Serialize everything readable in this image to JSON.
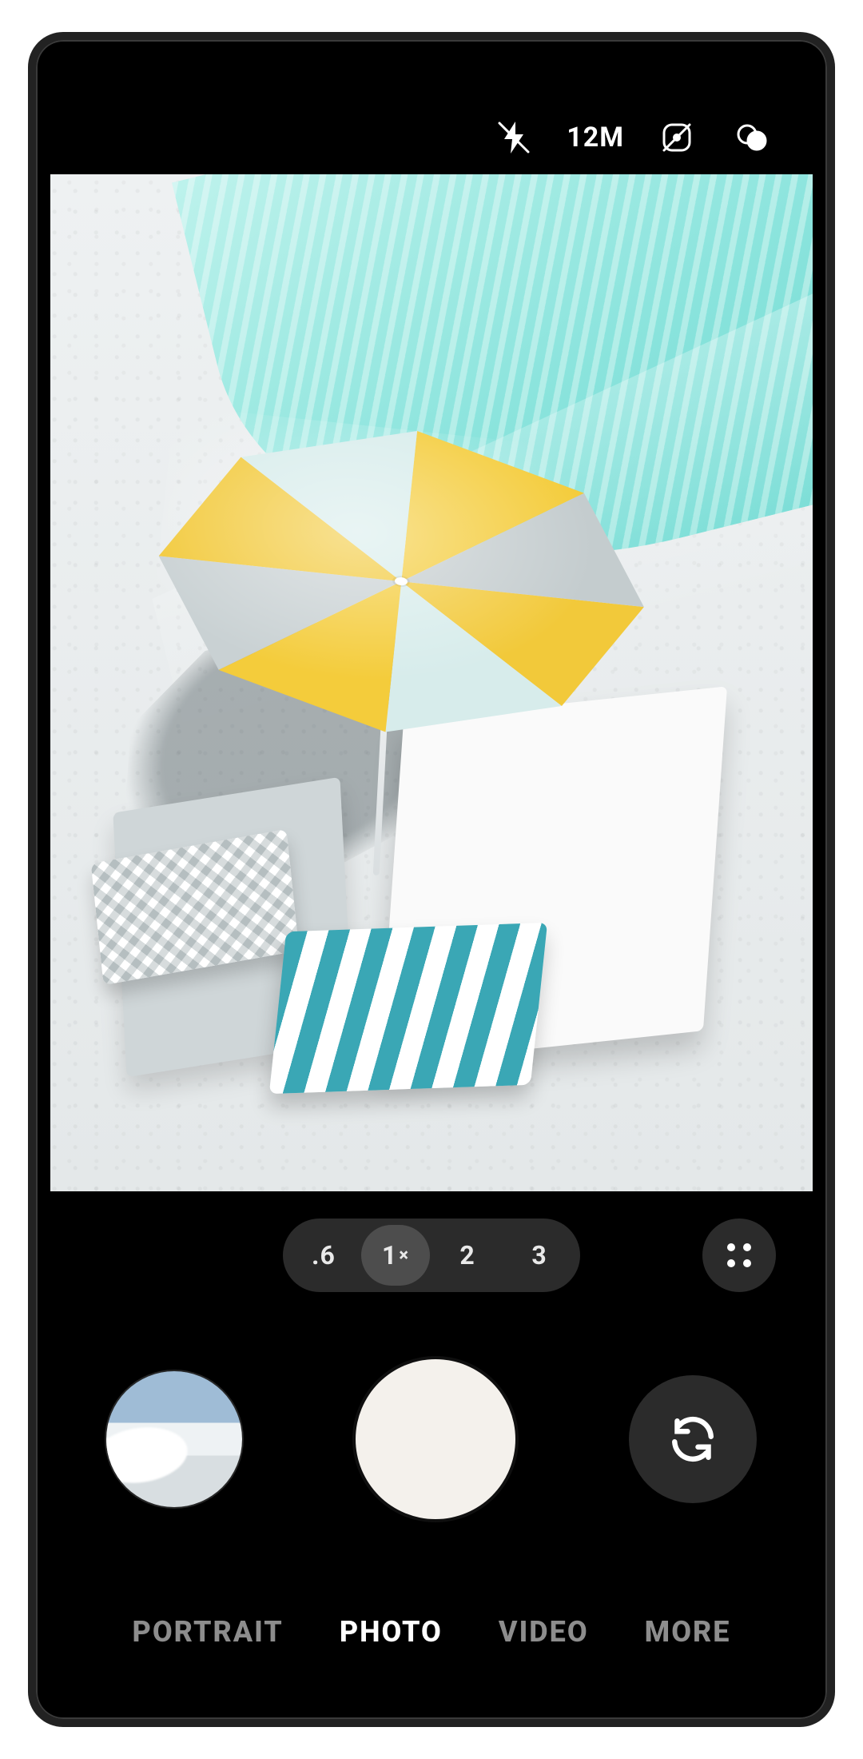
{
  "topbar": {
    "resolution_label": "12M"
  },
  "zoom": {
    "options": [
      ".6",
      "1",
      "2",
      "3"
    ],
    "active_index": 1,
    "multiplier_glyph": "×"
  },
  "modes": {
    "items": [
      "PORTRAIT",
      "PHOTO",
      "VIDEO",
      "MORE"
    ],
    "active_index": 1
  },
  "icons": {
    "flash": "flash-off-icon",
    "motion": "motion-photo-off-icon",
    "filter": "filters-icon",
    "grip": "grip-dots-icon",
    "switch": "camera-switch-icon"
  },
  "viewfinder": {
    "scene": "beach-umbrella"
  }
}
